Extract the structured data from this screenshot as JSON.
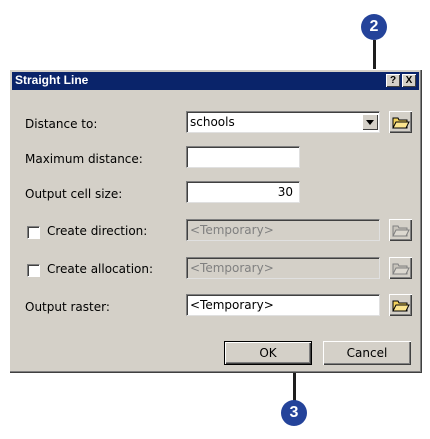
{
  "callouts": {
    "top": "2",
    "bottom": "3"
  },
  "dialog": {
    "title": "Straight Line",
    "help_label": "?",
    "close_label": "X",
    "distance_to": {
      "label": "Distance to:",
      "value": "schools"
    },
    "maximum_distance": {
      "label": "Maximum distance:",
      "value": ""
    },
    "output_cell_size": {
      "label": "Output cell size:",
      "value": "30"
    },
    "create_direction": {
      "label": "Create direction:",
      "checked": false,
      "value": "<Temporary>"
    },
    "create_allocation": {
      "label": "Create allocation:",
      "checked": false,
      "value": "<Temporary>"
    },
    "output_raster": {
      "label": "Output raster:",
      "value": "<Temporary>"
    },
    "ok_label": "OK",
    "cancel_label": "Cancel"
  },
  "colors": {
    "titlebar": "#0a246a",
    "callout": "#24439a",
    "dialog_bg": "#d4d0c8"
  },
  "icons": {
    "browse": "open-folder-icon",
    "dropdown": "chevron-down-icon"
  }
}
